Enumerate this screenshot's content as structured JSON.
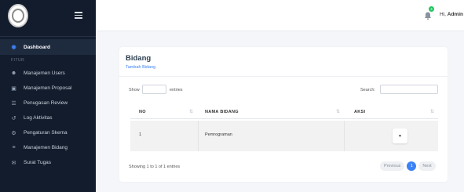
{
  "header": {
    "greeting": "Hi,",
    "user": "Admin",
    "notification_count": "4"
  },
  "sidebar": {
    "section_label": "FITUR",
    "items": [
      {
        "label": "Dashboard",
        "icon": "dashboard-icon"
      },
      {
        "label": "Manajemen Users",
        "icon": "users-icon"
      },
      {
        "label": "Manajemen Proposal",
        "icon": "folder-icon"
      },
      {
        "label": "Penugasan Review",
        "icon": "list-icon"
      },
      {
        "label": "Log Aktivitas",
        "icon": "history-icon"
      },
      {
        "label": "Pengaturan Skema",
        "icon": "cogs-icon"
      },
      {
        "label": "Manajemen Bidang",
        "icon": "layers-icon"
      },
      {
        "label": "Surat Tugas",
        "icon": "mail-icon"
      }
    ]
  },
  "page": {
    "title": "Bidang",
    "add_link": "Tambah Bidang"
  },
  "table_controls": {
    "show_label": "Show",
    "entries_label": "entries",
    "search_label": "Search:"
  },
  "table": {
    "columns": [
      "NO",
      "NAMA BIDANG",
      "AKSI"
    ],
    "rows": [
      {
        "no": "1",
        "nama_bidang": "Pemrograman"
      }
    ]
  },
  "footer": {
    "info": "Showing 1 to 1 of 1 entries",
    "previous": "Previous",
    "current_page": "1",
    "next": "Next"
  },
  "colors": {
    "sidebar_bg": "#131c2c",
    "accent": "#3b82f6",
    "badge": "#22c55e"
  }
}
